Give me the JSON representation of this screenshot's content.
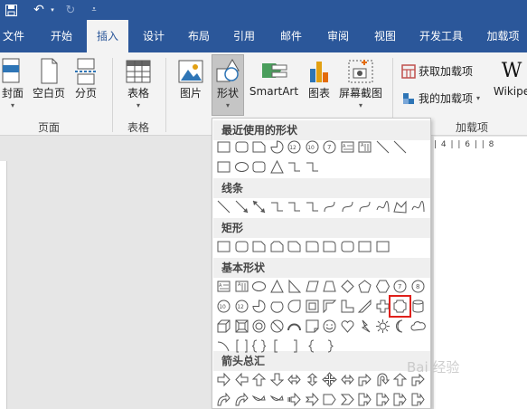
{
  "tabs": [
    {
      "label": "文件",
      "active": false
    },
    {
      "label": "开始",
      "active": false
    },
    {
      "label": "插入",
      "active": true
    },
    {
      "label": "设计",
      "active": false
    },
    {
      "label": "布局",
      "active": false
    },
    {
      "label": "引用",
      "active": false
    },
    {
      "label": "邮件",
      "active": false
    },
    {
      "label": "审阅",
      "active": false
    },
    {
      "label": "视图",
      "active": false
    },
    {
      "label": "开发工具",
      "active": false
    },
    {
      "label": "加载项",
      "active": false
    }
  ],
  "ribbon": {
    "cover": "封面",
    "blank": "空白页",
    "pagebreak": "分页",
    "table": "表格",
    "picture": "图片",
    "shapes": "形状",
    "smartart": "SmartArt",
    "chart": "图表",
    "screenshot": "屏幕截图",
    "get_addins": "获取加载项",
    "my_addins": "我的加载项",
    "wiki": "Wikipe",
    "group_pages": "页面",
    "group_tables": "表格",
    "group_addins": "加载项"
  },
  "ruler": "| 4 |   | 6 |   | 8",
  "dropdown": {
    "recent": "最近使用的形状",
    "lines": "线条",
    "rect": "矩形",
    "basic": "基本形状",
    "arrows": "箭头总汇"
  },
  "watermark": "Bai 经验",
  "colors": {
    "accent": "#2b579a",
    "selection": "#e0201b"
  }
}
